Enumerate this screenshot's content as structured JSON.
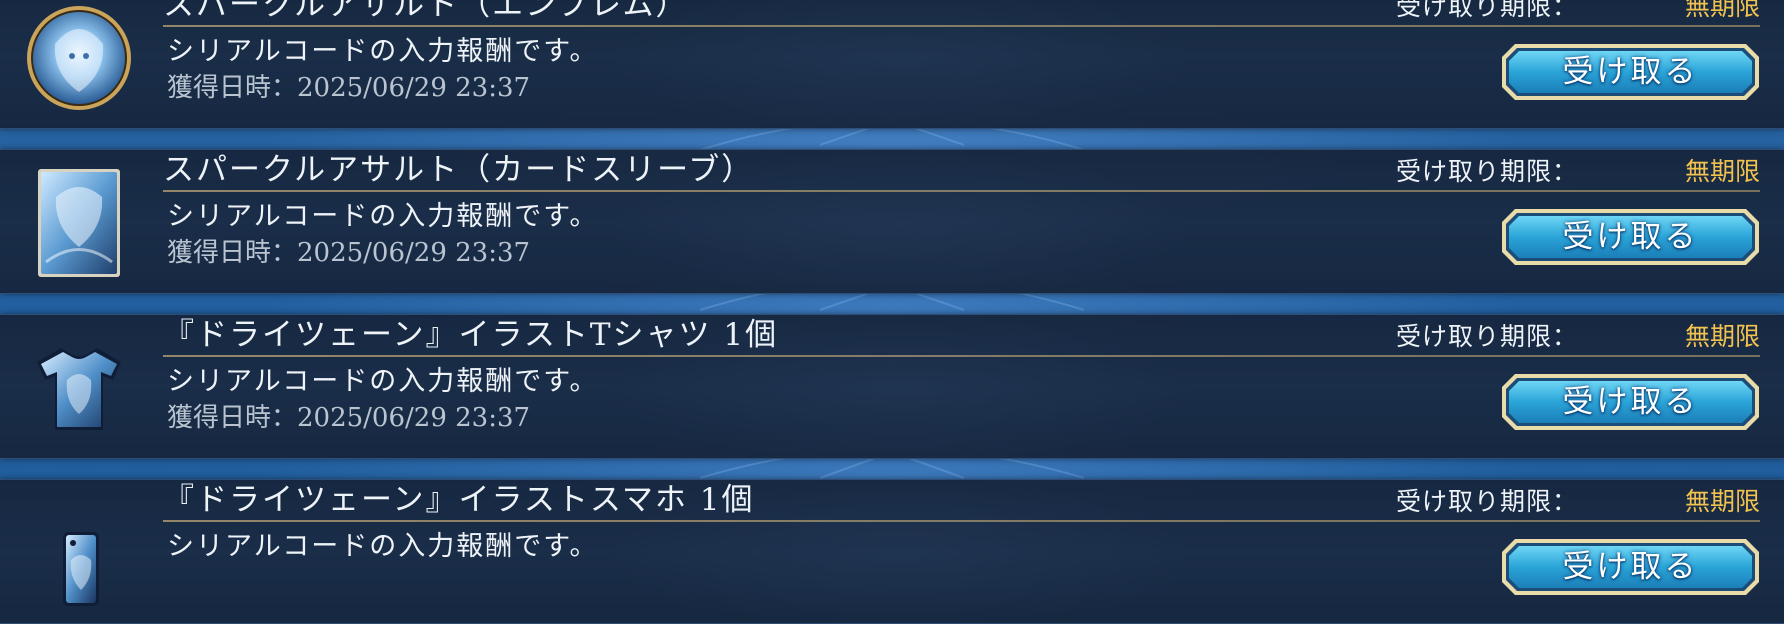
{
  "items": [
    {
      "title": "スパークルアサルト（エンブレム）",
      "deadline_label": "受け取り期限：",
      "deadline_value": "無期限",
      "description": "シリアルコードの入力報酬です。",
      "obtained": "獲得日時：2025/06/29 23:37",
      "button_label": "受け取る",
      "icon": "emblem-icon"
    },
    {
      "title": "スパークルアサルト（カードスリーブ）",
      "deadline_label": "受け取り期限：",
      "deadline_value": "無期限",
      "description": "シリアルコードの入力報酬です。",
      "obtained": "獲得日時：2025/06/29 23:37",
      "button_label": "受け取る",
      "icon": "card-sleeve-icon"
    },
    {
      "title": "『ドライツェーン』イラストTシャツ 1個",
      "deadline_label": "受け取り期限：",
      "deadline_value": "無期限",
      "description": "シリアルコードの入力報酬です。",
      "obtained": "獲得日時：2025/06/29 23:37",
      "button_label": "受け取る",
      "icon": "tshirt-icon"
    },
    {
      "title": "『ドライツェーン』イラストスマホ 1個",
      "deadline_label": "受け取り期限：",
      "deadline_value": "無期限",
      "description": "シリアルコードの入力報酬です。",
      "obtained": "",
      "button_label": "受け取る",
      "icon": "smartphone-icon"
    }
  ],
  "colors": {
    "deadline_value": "#f2c24e",
    "button_fill": "#2ba7d8",
    "button_border": "#e9dca8",
    "panel_bg": "#1b2c46"
  }
}
